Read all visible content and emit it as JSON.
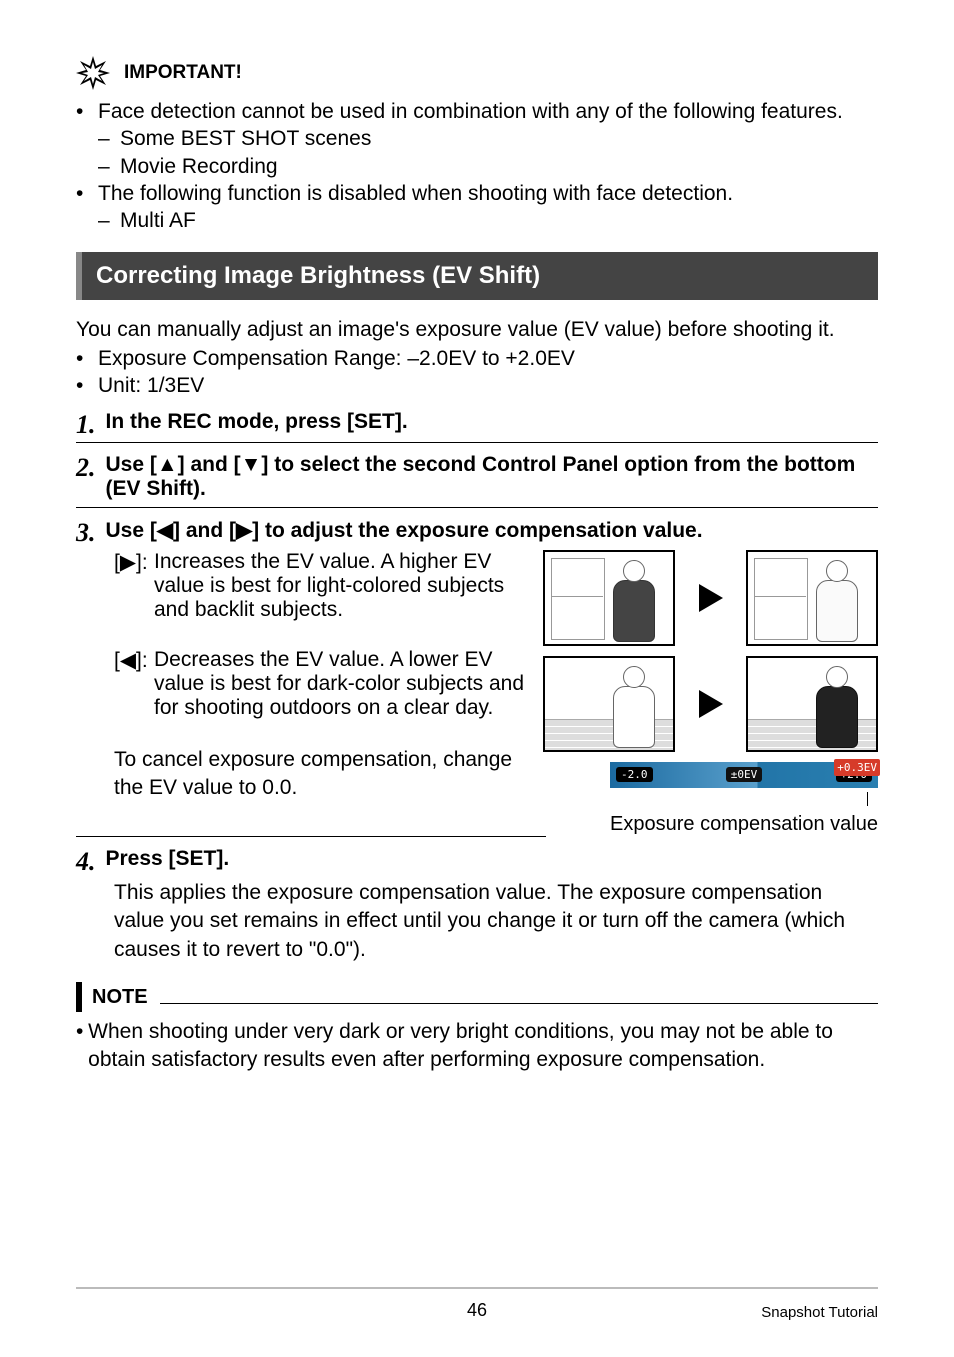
{
  "important": {
    "label": "IMPORTANT!",
    "bullet1": "Face detection cannot be used in combination with any of the following features.",
    "sub1a": "Some BEST SHOT scenes",
    "sub1b": "Movie Recording",
    "bullet2": "The following function is disabled when shooting with face detection.",
    "sub2a": "Multi AF"
  },
  "heading": "Correcting Image Brightness (EV Shift)",
  "intro": {
    "line1": "You can manually adjust an image's exposure value (EV value) before shooting it.",
    "b1": "Exposure Compensation Range: –2.0EV to +2.0EV",
    "b2": "Unit: 1/3EV"
  },
  "steps": {
    "s1": "In the REC mode, press [SET].",
    "s2": "Use [▲] and [▼] to select the second Control Panel option from the bottom (EV Shift).",
    "s3": "Use [◀] and [▶] to adjust the exposure compensation value.",
    "s3_right_label": "[▶]:",
    "s3_right_text": "Increases the EV value. A higher EV value is best for light-colored subjects and backlit subjects.",
    "s3_left_label": "[◀]:",
    "s3_left_text": "Decreases the EV value. A lower EV value is best for dark-color subjects and for shooting outdoors on a clear day.",
    "s3_cancel": "To cancel exposure compensation, change the EV value to 0.0.",
    "s4_title": "Press [SET].",
    "s4_body": "This applies the exposure compensation value. The exposure compensation value you set remains in effect until you change it or turn off the camera (which causes it to revert to \"0.0\")."
  },
  "evbar": {
    "left": "-2.0",
    "mid": "±0EV",
    "right": "+2.0",
    "value": "+0.3EV"
  },
  "caption": "Exposure compensation value",
  "note": {
    "label": "NOTE",
    "text": "When shooting under very dark or very bright conditions, you may not be able to obtain satisfactory results even after performing exposure compensation."
  },
  "footer": {
    "page": "46",
    "section": "Snapshot Tutorial"
  }
}
